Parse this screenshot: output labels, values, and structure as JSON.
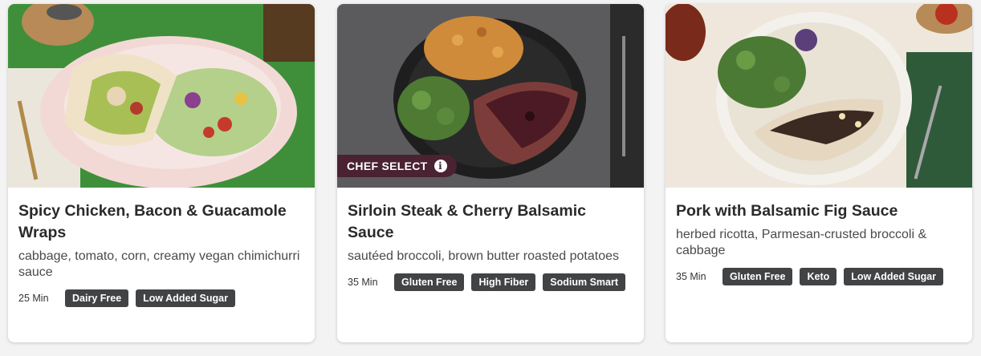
{
  "cards": [
    {
      "title": "Spicy Chicken, Bacon & Guacamole Wraps",
      "description": "cabbage, tomato, corn, creamy vegan chimichurri sauce",
      "time": "25 Min",
      "tags": [
        "Dairy Free",
        "Low Added Sugar"
      ],
      "badge": ""
    },
    {
      "title": "Sirloin Steak & Cherry Balsamic Sauce",
      "description": "sautéed broccoli, brown butter roasted potatoes",
      "time": "35 Min",
      "tags": [
        "Gluten Free",
        "High Fiber",
        "Sodium Smart"
      ],
      "badge": "CHEF SELECT",
      "badge_icon": "info-icon"
    },
    {
      "title": "Pork with Balsamic Fig Sauce",
      "description": "herbed ricotta, Parmesan-crusted broccoli & cabbage",
      "time": "35 Min",
      "tags": [
        "Gluten Free",
        "Keto",
        "Low Added Sugar"
      ],
      "badge": ""
    }
  ],
  "colors": {
    "tag_bg": "#414345",
    "badge_bg": "#4a2232",
    "page_bg": "#f3f3f3"
  }
}
